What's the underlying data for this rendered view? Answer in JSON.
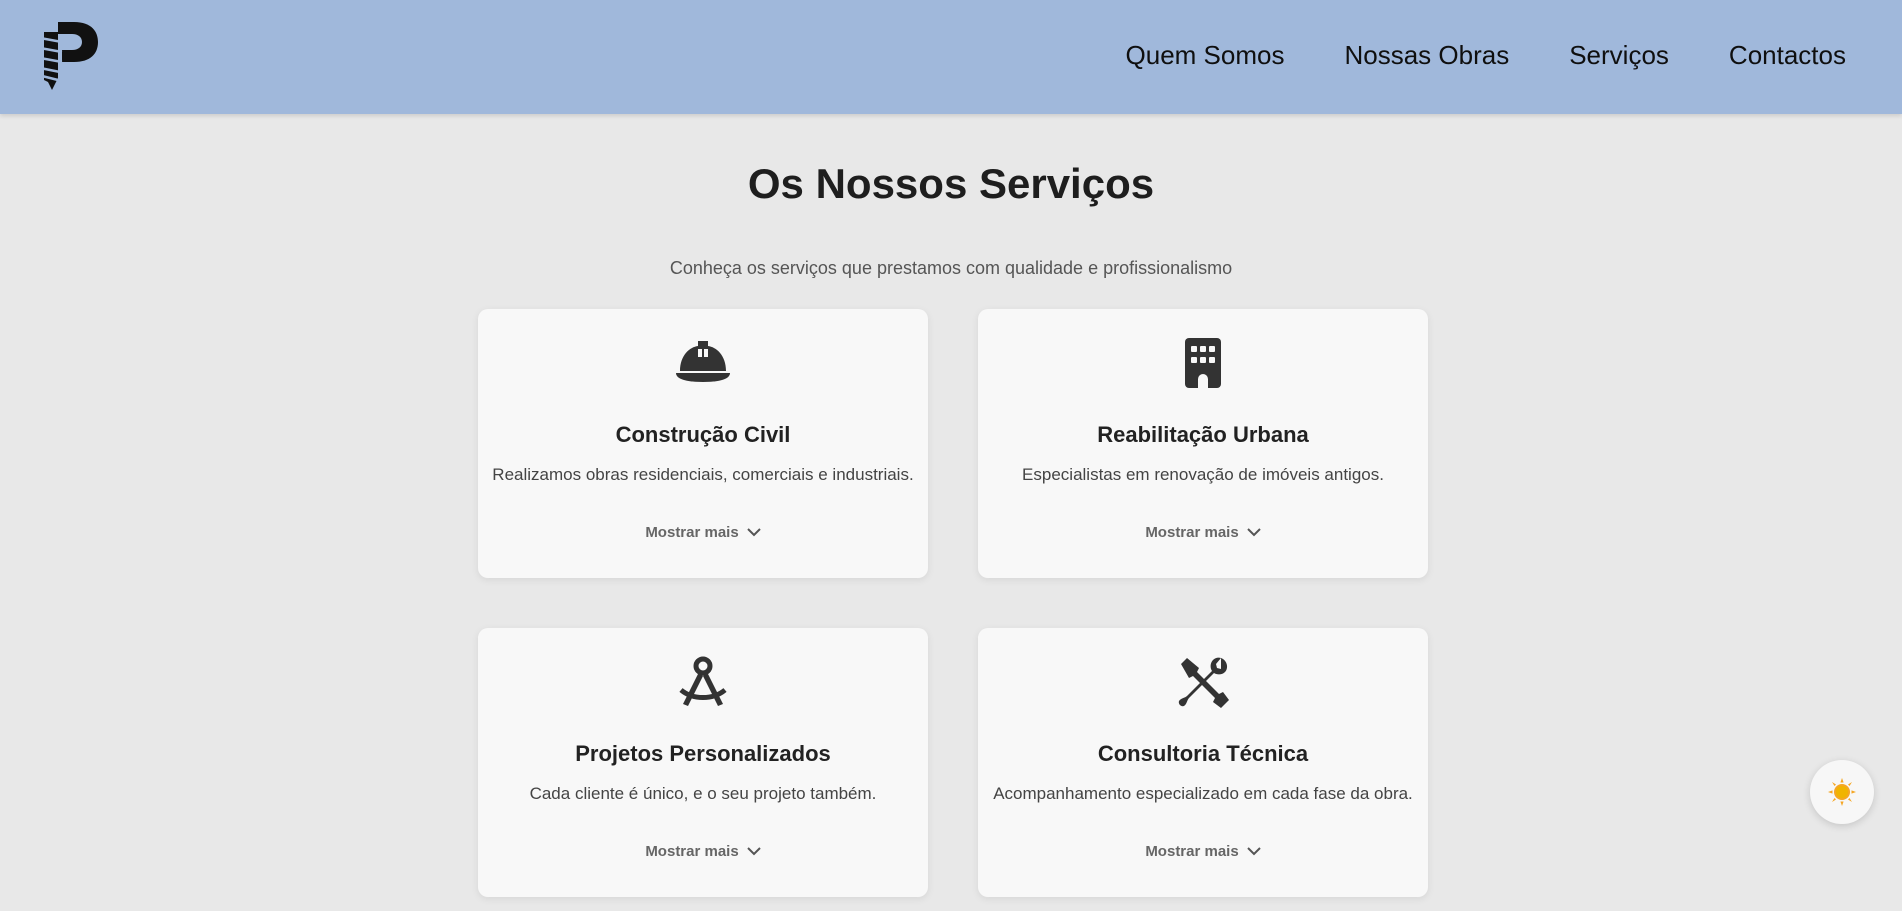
{
  "header": {
    "nav": [
      "Quem Somos",
      "Nossas Obras",
      "Serviços",
      "Contactos"
    ]
  },
  "main": {
    "title": "Os Nossos Serviços",
    "subtitle": "Conheça os serviços que prestamos com qualidade e profissionalismo",
    "cards": [
      {
        "icon": "hard-hat-icon",
        "title": "Construção Civil",
        "description": "Realizamos obras residenciais, comerciais e industriais.",
        "more_label": "Mostrar mais"
      },
      {
        "icon": "building-icon",
        "title": "Reabilitação Urbana",
        "description": "Especialistas em renovação de imóveis antigos.",
        "more_label": "Mostrar mais"
      },
      {
        "icon": "compass-drafting-icon",
        "title": "Projetos Personalizados",
        "description": "Cada cliente é único, e o seu projeto também.",
        "more_label": "Mostrar mais"
      },
      {
        "icon": "screwdriver-wrench-icon",
        "title": "Consultoria Técnica",
        "description": "Acompanhamento especializado em cada fase da obra.",
        "more_label": "Mostrar mais"
      }
    ]
  },
  "theme_toggle": {
    "icon": "sun-icon"
  },
  "colors": {
    "header_bg": "#a0b8db",
    "page_bg": "#e8e8e8",
    "card_bg": "#f8f8f8",
    "sun": "#f5a623"
  }
}
